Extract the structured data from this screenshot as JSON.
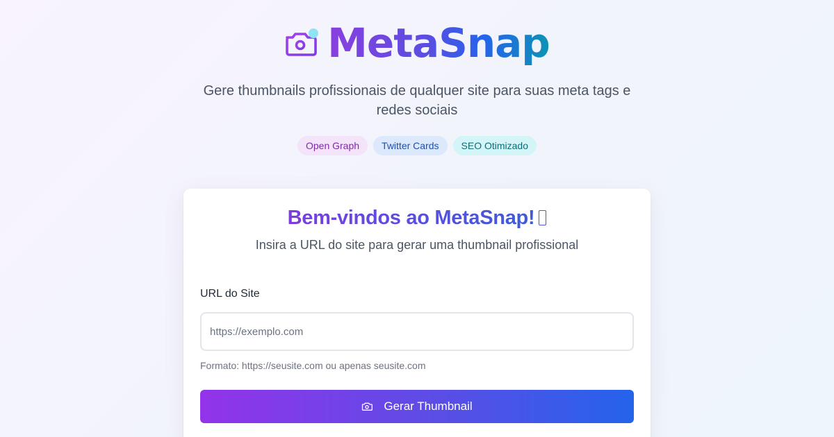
{
  "header": {
    "brand_name": "MetaSnap",
    "brand_icon": "camera-icon",
    "subtitle": "Gere thumbnails profissionais de qualquer site para suas meta tags e redes sociais",
    "badges": [
      "Open Graph",
      "Twitter Cards",
      "SEO Otimizado"
    ]
  },
  "card": {
    "title": "Bem-vindos ao MetaSnap!",
    "lead": "Insira a URL do site para gerar uma thumbnail profissional",
    "url_label": "URL do Site",
    "url_placeholder": "https://exemplo.com",
    "url_value": "",
    "hint": "Formato: https://seusite.com ou apenas seusite.com",
    "submit_label": "Gerar Thumbnail",
    "submit_icon": "camera-icon"
  },
  "colors": {
    "brand_purple": "#8a3fe0",
    "brand_blue": "#2563eb",
    "brand_teal": "#0e93b4",
    "icon_dot": "#8fe3f3"
  }
}
